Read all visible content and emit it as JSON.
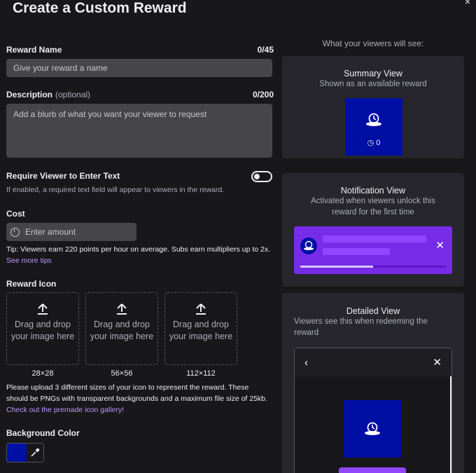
{
  "title": "Create a Custom Reward",
  "close_glyph": "×",
  "form": {
    "reward_name": {
      "label": "Reward Name",
      "count": "0/45",
      "placeholder": "Give your reward a name"
    },
    "description": {
      "label": "Description",
      "optional": "(optional)",
      "count": "0/200",
      "placeholder": "Add a blurb of what you want your viewer to request"
    },
    "require_text": {
      "label": "Require Viewer to Enter Text",
      "help": "If enabled, a required text field will appear to viewers in the reward.",
      "enabled": false
    },
    "cost": {
      "label": "Cost",
      "placeholder": "Enter amount",
      "tip": "Tip: Viewers earn 220 points per hour on average. Subs earn multipliers up to 2x.",
      "tip_link": "See more tips"
    },
    "reward_icon": {
      "label": "Reward Icon",
      "dropzones": [
        {
          "text": "Drag and drop your image here",
          "size": "28×28"
        },
        {
          "text": "Drag and drop your image here",
          "size": "56×56"
        },
        {
          "text": "Drag and drop your image here",
          "size": "112×112"
        }
      ],
      "help": "Please upload 3 different sizes of your icon to represent the reward. These should be PNGs with transparent backgrounds and a maximum file size of 25kb.",
      "help_link": "Check out the premade icon gallery!"
    },
    "background_color": {
      "label": "Background Color",
      "value": "#000fa3"
    }
  },
  "preview": {
    "heading": "What your viewers will see:",
    "summary": {
      "title": "Summary View",
      "subtitle": "Shown as an available reward",
      "cost": "0"
    },
    "notification": {
      "title": "Notification View",
      "subtitle": "Activated when viewers unlock this reward for the first time",
      "progress": 0.5,
      "close_glyph": "✕"
    },
    "detailed": {
      "title": "Detailed View",
      "subtitle": "Viewers see this when redeeming the reward",
      "back_glyph": "‹",
      "close_glyph": "✕"
    }
  },
  "colors": {
    "accent": "#9147ff",
    "reward_bg": "#000fa3",
    "panel": "#26262c",
    "input": "#464649"
  }
}
